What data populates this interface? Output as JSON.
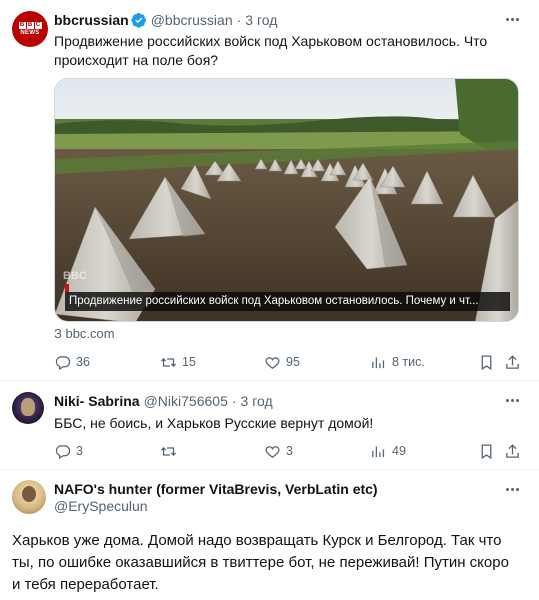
{
  "tweet1": {
    "name": "bbcrussian",
    "handle": "@bbcrussian",
    "time": "3 год",
    "avatar": {
      "lines": [
        "B",
        "B",
        "C"
      ],
      "label": "NEWS"
    },
    "text_line1": "Продвижение российских войск под Харьковом остановилось. Что",
    "text_line2": "происходит на поле боя?",
    "media": {
      "caption": "Продвижение российских войск под Харьковом остановилось. Почему и чт...",
      "watermark": "BBC"
    },
    "link_source": "З bbc.com",
    "actions": {
      "reply_count": "36",
      "retweet_count": "15",
      "like_count": "95",
      "views_count": "8 тис."
    }
  },
  "tweet2": {
    "name": "Niki- Sabrina",
    "handle": "@Niki756605",
    "time": "3 год",
    "text": "ББС, не боись, и Харьков Русские вернут домой!",
    "actions": {
      "reply_count": "3",
      "retweet_count": "",
      "like_count": "3",
      "views_count": "49"
    }
  },
  "tweet3": {
    "name": "NAFO's hunter (former VitaBrevis, VerbLatin etc)",
    "handle": "@ErySpeculun",
    "text_line1": "Харьков уже дома. Домой надо возвращать Курск и Белгород. Так что",
    "text_line2": "ты, по ошибке оказавшийся в твиттере бот, не переживай! Путин скоро",
    "text_line3": "и тебя переработает."
  },
  "colors": {
    "accent": "#1d9bf0",
    "muted": "#536471",
    "text": "#0f1419",
    "bbc_red": "#b80000",
    "border": "#cfd9de"
  },
  "icons": [
    "reply-icon",
    "retweet-icon",
    "like-icon",
    "views-icon",
    "bookmark-icon",
    "share-icon",
    "verified-badge-icon",
    "more-icon"
  ]
}
